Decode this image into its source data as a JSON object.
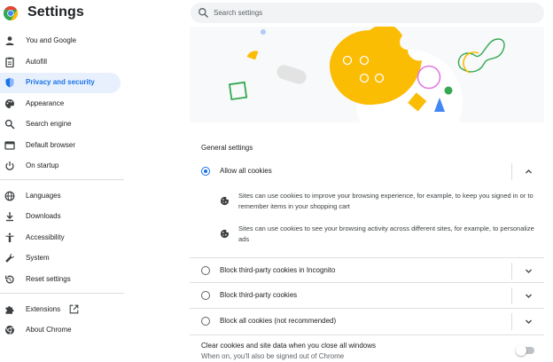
{
  "header": {
    "title": "Settings",
    "logo_icon": "chrome-logo-icon",
    "search": {
      "placeholder": "Search settings",
      "value": ""
    }
  },
  "sidebar": {
    "items": [
      {
        "label": "You and Google",
        "icon": "person-icon",
        "active": false
      },
      {
        "label": "Autofill",
        "icon": "clipboard-icon",
        "active": false
      },
      {
        "label": "Privacy and security",
        "icon": "shield-icon",
        "active": true
      },
      {
        "label": "Appearance",
        "icon": "palette-icon",
        "active": false
      },
      {
        "label": "Search engine",
        "icon": "search-icon",
        "active": false
      },
      {
        "label": "Default browser",
        "icon": "browser-icon",
        "active": false
      },
      {
        "label": "On startup",
        "icon": "power-icon",
        "active": false
      },
      {
        "label": "Languages",
        "icon": "globe-icon",
        "active": false
      },
      {
        "label": "Downloads",
        "icon": "download-icon",
        "active": false
      },
      {
        "label": "Accessibility",
        "icon": "accessibility-icon",
        "active": false
      },
      {
        "label": "System",
        "icon": "wrench-icon",
        "active": false
      },
      {
        "label": "Reset settings",
        "icon": "reset-icon",
        "active": false
      },
      {
        "label": "Extensions",
        "icon": "puzzle-icon",
        "active": false
      },
      {
        "label": "About Chrome",
        "icon": "chrome-icon",
        "active": false
      }
    ]
  },
  "main": {
    "section_title": "General settings",
    "options": [
      {
        "label": "Allow all cookies",
        "selected": true,
        "expanded": true
      },
      {
        "label": "Block third-party cookies in Incognito",
        "selected": false,
        "expanded": false
      },
      {
        "label": "Block third-party cookies",
        "selected": false,
        "expanded": false
      },
      {
        "label": "Block all cookies (not recommended)",
        "selected": false,
        "expanded": false
      }
    ],
    "details": [
      "Sites can use cookies to improve your browsing experience, for example, to keep you signed in or to remember items in your shopping cart",
      "Sites can use cookies to see your browsing activity across different sites, for example, to personalize ads"
    ],
    "clear_on_exit": {
      "title": "Clear cookies and site data when you close all windows",
      "subtitle": "When on, you'll also be signed out of Chrome",
      "enabled": false
    }
  },
  "colors": {
    "accent": "#1a73e8",
    "active_bg": "#e8f0fe",
    "cookie_yellow": "#fbbc04",
    "green": "#34a853",
    "magenta": "#e07be0"
  }
}
